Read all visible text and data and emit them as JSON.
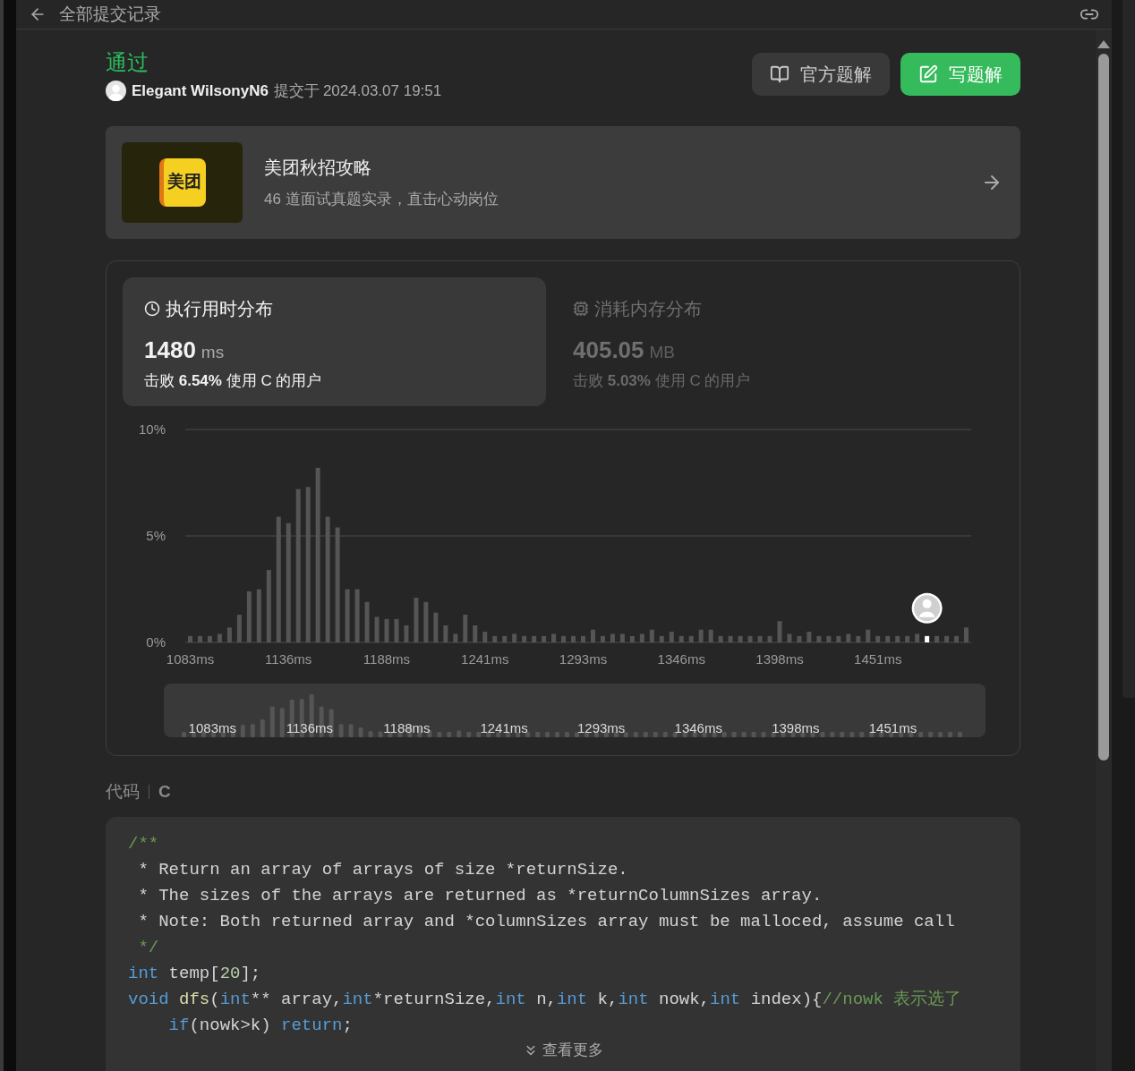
{
  "header": {
    "title": "全部提交记录"
  },
  "submission": {
    "status": "通过",
    "user": "Elegant WilsonyN6",
    "submitted_label": "提交于",
    "time": "2024.03.07 19:51"
  },
  "actions": [
    {
      "kind": "secondary",
      "label": "官方题解"
    },
    {
      "kind": "primary",
      "label": "写题解"
    }
  ],
  "promo": {
    "logo_text": "美团",
    "title": "美团秋招攻略",
    "subtitle": "46 道面试真题实录，直击心动岗位"
  },
  "stats_tabs": [
    {
      "kind": "time",
      "selected": true,
      "title": "执行用时分布",
      "value": "1480",
      "unit": "ms",
      "beat": "击败 **6.54%** 使用 C 的用户"
    },
    {
      "kind": "memory",
      "selected": false,
      "title": "消耗内存分布",
      "value": "405.05",
      "unit": "MB",
      "beat": "击败 **5.03%** 使用 C 的用户"
    }
  ],
  "chart_data": {
    "type": "bar",
    "stacked": true,
    "ylim": [
      0,
      10
    ],
    "yticks": [
      {
        "value": 0,
        "label": "0%"
      },
      {
        "value": 5,
        "label": "5%"
      },
      {
        "value": 10,
        "label": "10%"
      }
    ],
    "categories": [
      "1083ms",
      null,
      null,
      null,
      null,
      null,
      null,
      null,
      null,
      null,
      "1136ms",
      null,
      null,
      null,
      null,
      null,
      null,
      null,
      null,
      null,
      "1188ms",
      null,
      null,
      null,
      null,
      null,
      null,
      null,
      null,
      null,
      "1241ms",
      null,
      null,
      null,
      null,
      null,
      null,
      null,
      null,
      null,
      "1293ms",
      null,
      null,
      null,
      null,
      null,
      null,
      null,
      null,
      null,
      "1346ms",
      null,
      null,
      null,
      null,
      null,
      null,
      null,
      null,
      null,
      "1398ms",
      null,
      null,
      null,
      null,
      null,
      null,
      null,
      null,
      null,
      "1451ms",
      null,
      null,
      null,
      null,
      null,
      null,
      null,
      null,
      null
    ],
    "series": [
      {
        "color": "#555555",
        "values": [
          0.3,
          0.3,
          0.3,
          0.4,
          0.7,
          1.3,
          2.4,
          2.5,
          3.4,
          5.9,
          5.6,
          7.2,
          7.3,
          8.2,
          5.9,
          5.4,
          2.5,
          2.5,
          1.9,
          1.2,
          1.1,
          1.1,
          0.8,
          2.1,
          1.9,
          1.4,
          0.8,
          0.4,
          1.3,
          0.8,
          0.5,
          0.3,
          0.3,
          0.4,
          0.3,
          0.3,
          0.3,
          0.4,
          0.3,
          0.3,
          0.3,
          0.6,
          0.3,
          0.4,
          0.4,
          0.3,
          0.4,
          0.6,
          0.3,
          0.5,
          0.3,
          0.3,
          0.6,
          0.6,
          0.3,
          0.3,
          0.3,
          0.3,
          0.3,
          0.3,
          1.0,
          0.4,
          0.3,
          0.5,
          0.3,
          0.3,
          0.3,
          0.4,
          0.3,
          0.6,
          0.3,
          0.3,
          0.3,
          0.3,
          0.4,
          null,
          0.3,
          0.3,
          0.3,
          0.7
        ]
      },
      {
        "color": "#ffffff",
        "values": [
          null,
          null,
          null,
          null,
          null,
          null,
          null,
          null,
          null,
          null,
          null,
          null,
          null,
          null,
          null,
          null,
          null,
          null,
          null,
          null,
          null,
          null,
          null,
          null,
          null,
          null,
          null,
          null,
          null,
          null,
          null,
          null,
          null,
          null,
          null,
          null,
          null,
          null,
          null,
          null,
          null,
          null,
          null,
          null,
          null,
          null,
          null,
          null,
          null,
          null,
          null,
          null,
          null,
          null,
          null,
          null,
          null,
          null,
          null,
          null,
          null,
          null,
          null,
          null,
          null,
          null,
          null,
          null,
          null,
          null,
          null,
          null,
          null,
          null,
          null,
          0.3,
          null,
          null,
          null,
          null
        ]
      }
    ]
  },
  "navigator": {
    "labels": [
      "1083ms",
      "1136ms",
      "1188ms",
      "1241ms",
      "1293ms",
      "1346ms",
      "1398ms",
      "1451ms"
    ]
  },
  "code_section": {
    "label": "代码",
    "language": "C",
    "more": "查看更多",
    "lines": [
      [
        {
          "kind": "comment",
          "t": "/**"
        }
      ],
      [
        {
          "kind": "plain",
          "t": " * Return an array of arrays of size *returnSize."
        }
      ],
      [
        {
          "kind": "plain",
          "t": " * The sizes of the arrays are returned as *returnColumnSizes array."
        }
      ],
      [
        {
          "kind": "plain",
          "t": " * Note: Both returned array and *columnSizes array must be malloced, assume call"
        }
      ],
      [
        {
          "kind": "comment",
          "t": " */"
        }
      ],
      [
        {
          "kind": "keyword",
          "t": "int"
        },
        {
          "kind": "plain",
          "t": " temp["
        },
        {
          "kind": "number",
          "t": "20"
        },
        {
          "kind": "plain",
          "t": "];"
        }
      ],
      [
        {
          "kind": "keyword",
          "t": "void"
        },
        {
          "kind": "func",
          "t": " dfs"
        },
        {
          "kind": "plain",
          "t": "("
        },
        {
          "kind": "keyword",
          "t": "int"
        },
        {
          "kind": "plain",
          "t": "** array,"
        },
        {
          "kind": "keyword",
          "t": "int"
        },
        {
          "kind": "plain",
          "t": "*returnSize,"
        },
        {
          "kind": "keyword",
          "t": "int"
        },
        {
          "kind": "plain",
          "t": " n,"
        },
        {
          "kind": "keyword",
          "t": "int"
        },
        {
          "kind": "plain",
          "t": " k,"
        },
        {
          "kind": "keyword",
          "t": "int"
        },
        {
          "kind": "plain",
          "t": " nowk,"
        },
        {
          "kind": "keyword",
          "t": "int"
        },
        {
          "kind": "plain",
          "t": " index){"
        },
        {
          "kind": "comment",
          "t": "//nowk 表示选了"
        }
      ],
      [
        {
          "kind": "keyword",
          "t": "    if"
        },
        {
          "kind": "plain",
          "t": "(nowk>k) "
        },
        {
          "kind": "keyword",
          "t": "return"
        },
        {
          "kind": "plain",
          "t": ";"
        }
      ]
    ]
  }
}
